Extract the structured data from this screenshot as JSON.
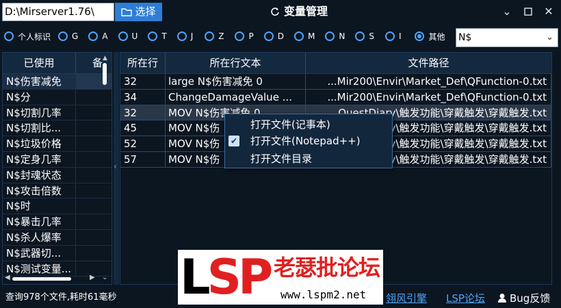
{
  "toolbar": {
    "path_value": "D:\\Mirserver1.76\\",
    "select_label": "选择",
    "select_icon": "folder-icon"
  },
  "window": {
    "title": "变量管理",
    "title_icon": "refresh-icon",
    "minimize_icon": "chevron-down-icon",
    "restore_icon": "window-icon",
    "close_icon": "close-icon"
  },
  "filters": {
    "options": [
      "个人标识",
      "G",
      "A",
      "U",
      "T",
      "J",
      "Z",
      "P",
      "D",
      "M",
      "N",
      "S",
      "I",
      "其他"
    ],
    "selected": "其他",
    "variable_select_value": "N$"
  },
  "left_table": {
    "header_used": "已使用",
    "header_note": "备",
    "rows": [
      "N$伤害减免",
      "N$分",
      "N$切割几率",
      "N$切割比...",
      "N$垃圾价格",
      "N$定身几率",
      "N$封魂状态",
      "N$攻击倍数",
      "N$时",
      "N$暴击几率",
      "N$杀人爆率",
      "N$武器切...",
      "N$测试变量..."
    ]
  },
  "right_table": {
    "headers": [
      "所在行",
      "所在行文本",
      "文件路径"
    ],
    "rows": [
      {
        "line": "32",
        "text": "large N$伤害减免 0",
        "path": "...Mir200\\Envir\\Market_Def\\QFunction-0.txt"
      },
      {
        "line": "34",
        "text": "ChangeDamageValue ...",
        "path": "...Mir200\\Envir\\Market_Def\\QFunction-0.txt"
      },
      {
        "line": "32",
        "text": "MOV N$伤害减免 0",
        "path": "...QuestDiary\\触发功能\\穿戴触发\\穿戴触发.txt"
      },
      {
        "line": "45",
        "text": "MOV N$伤",
        "path": "...QuestDiary\\触发功能\\穿戴触发\\穿戴触发.txt"
      },
      {
        "line": "52",
        "text": "MOV N$伤",
        "path": "...QuestDiary\\触发功能\\穿戴触发\\穿戴触发.txt"
      },
      {
        "line": "57",
        "text": "MOV N$伤",
        "path": "...QuestDiary\\触发功能\\穿戴触发\\穿戴触发.txt"
      }
    ]
  },
  "context_menu": {
    "items": [
      "打开文件(记事本)",
      "打开文件(Notepad++)",
      "打开文件目录"
    ],
    "checked_index": 1
  },
  "status": {
    "query_text": "查询978个文件,耗时61毫秒",
    "link_engine": "翎风引擎",
    "link_lsp": "LSP论坛",
    "bug_label": "Bug反馈",
    "bug_icon": "user-icon"
  },
  "watermark": {
    "logo": "LSP",
    "name": "老瑟批论坛",
    "url": "www.lspm2.net"
  }
}
